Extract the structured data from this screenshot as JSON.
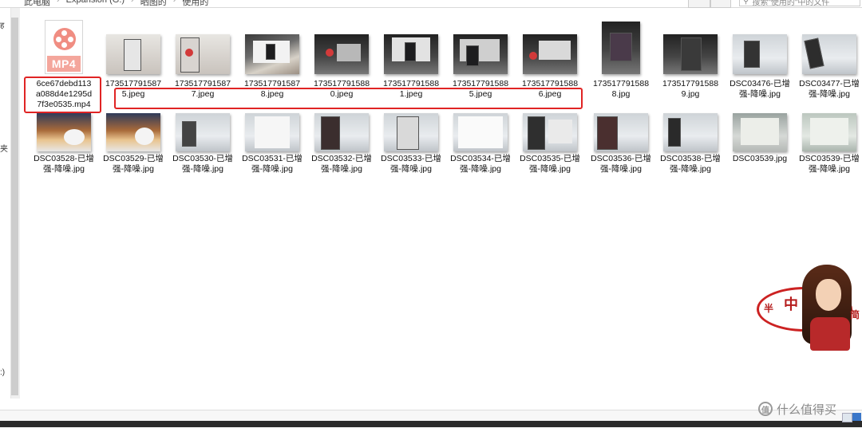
{
  "breadcrumb": {
    "items": [
      "此电脑",
      "Expansion (G:)",
      "晒图的",
      "使用的"
    ],
    "separator": "›"
  },
  "search": {
    "placeholder": "搜索\"使用的\"中的文件"
  },
  "nav_fragments": [
    "ह",
    "夹",
    ":)"
  ],
  "files": [
    {
      "kind": "video",
      "icon_label": "MP4",
      "name": "6ce67debd113a088d4e1295d7f3e0535.mp4"
    },
    {
      "kind": "photo",
      "name": "1735177915875.jpeg"
    },
    {
      "kind": "photo",
      "name": "1735177915877.jpeg"
    },
    {
      "kind": "photo",
      "name": "1735177915878.jpeg"
    },
    {
      "kind": "photo",
      "name": "1735177915880.jpeg"
    },
    {
      "kind": "photo",
      "name": "1735177915881.jpeg"
    },
    {
      "kind": "photo",
      "name": "1735177915885.jpeg"
    },
    {
      "kind": "photo",
      "name": "1735177915886.jpeg"
    },
    {
      "kind": "photo",
      "name": "1735177915888.jpg"
    },
    {
      "kind": "photo",
      "name": "1735177915889.jpg"
    },
    {
      "kind": "photo",
      "name": "DSC03476-已增强-降噪.jpg"
    },
    {
      "kind": "photo",
      "name": "DSC03477-已增强-降噪.jpg"
    },
    {
      "kind": "photo",
      "name": "DSC03528-已增强-降噪.jpg"
    },
    {
      "kind": "photo",
      "name": "DSC03529-已增强-降噪.jpg"
    },
    {
      "kind": "photo",
      "name": "DSC03530-已增强-降噪.jpg"
    },
    {
      "kind": "photo",
      "name": "DSC03531-已增强-降噪.jpg"
    },
    {
      "kind": "photo",
      "name": "DSC03532-已增强-降噪.jpg"
    },
    {
      "kind": "photo",
      "name": "DSC03533-已增强-降噪.jpg"
    },
    {
      "kind": "photo",
      "name": "DSC03534-已增强-降噪.jpg"
    },
    {
      "kind": "photo",
      "name": "DSC03535-已增强-降噪.jpg"
    },
    {
      "kind": "photo",
      "name": "DSC03536-已增强-降噪.jpg"
    },
    {
      "kind": "photo",
      "name": "DSC03538-已增强-降噪.jpg"
    },
    {
      "kind": "photo",
      "name": "DSC03539.jpg"
    },
    {
      "kind": "photo",
      "name": "DSC03539-已增强-降噪.jpg"
    }
  ],
  "name_lines": [
    [
      "6ce67debd113",
      "a088d4e1295d",
      "7f3e0535.mp4"
    ],
    [
      "173517791587",
      "5.jpeg"
    ],
    [
      "173517791587",
      "7.jpeg"
    ],
    [
      "173517791587",
      "8.jpeg"
    ],
    [
      "173517791588",
      "0.jpeg"
    ],
    [
      "173517791588",
      "1.jpeg"
    ],
    [
      "173517791588",
      "5.jpeg"
    ],
    [
      "173517791588",
      "6.jpeg"
    ],
    [
      "173517791588",
      "8.jpg"
    ],
    [
      "173517791588",
      "9.jpg"
    ],
    [
      "DSC03476-已增",
      "强-降噪.jpg"
    ],
    [
      "DSC03477-已增",
      "强-降噪.jpg"
    ],
    [
      "DSC03528-已增",
      "强-降噪.jpg"
    ],
    [
      "DSC03529-已增",
      "强-降噪.jpg"
    ],
    [
      "DSC03530-已增",
      "强-降噪.jpg"
    ],
    [
      "DSC03531-已增",
      "强-降噪.jpg"
    ],
    [
      "DSC03532-已增",
      "强-降噪.jpg"
    ],
    [
      "DSC03533-已增",
      "强-降噪.jpg"
    ],
    [
      "DSC03534-已增",
      "强-降噪.jpg"
    ],
    [
      "DSC03535-已增",
      "强-降噪.jpg"
    ],
    [
      "DSC03536-已增",
      "强-降噪.jpg"
    ],
    [
      "DSC03538-已增",
      "强-降噪.jpg"
    ],
    [
      "DSC03539.jpg"
    ],
    [
      "DSC03539-已增",
      "强-降噪.jpg"
    ]
  ],
  "annotations": {
    "highlight_color": "#e02424"
  },
  "watermark": {
    "chars": [
      "半",
      "中",
      "简"
    ]
  },
  "brand": {
    "text": "什么值得买",
    "icon": "值"
  }
}
